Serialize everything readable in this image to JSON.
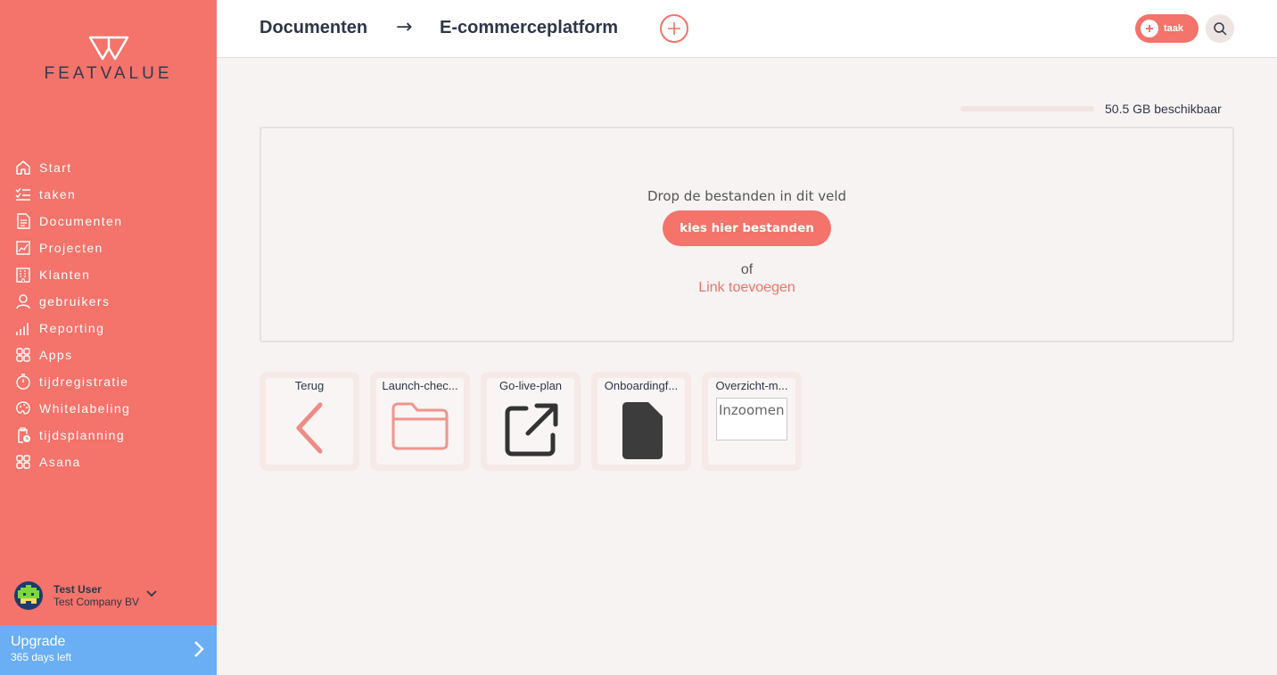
{
  "brand": {
    "name": "FEATVALUE",
    "accent": "#f4736a",
    "upgrade_color": "#6aaef4"
  },
  "sidebar": {
    "items": [
      {
        "label": "Start",
        "icon": "home-icon"
      },
      {
        "label": "taken",
        "icon": "checklist-icon"
      },
      {
        "label": "Documenten",
        "icon": "document-icon"
      },
      {
        "label": "Projecten",
        "icon": "chart-icon"
      },
      {
        "label": "Klanten",
        "icon": "building-icon"
      },
      {
        "label": "gebruikers",
        "icon": "user-icon"
      },
      {
        "label": "Reporting",
        "icon": "bar-chart-icon"
      },
      {
        "label": "Apps",
        "icon": "apps-icon"
      },
      {
        "label": "tijdregistratie",
        "icon": "stopwatch-icon"
      },
      {
        "label": "Whitelabeling",
        "icon": "palette-icon"
      },
      {
        "label": "tijdsplanning",
        "icon": "clipboard-clock-icon"
      },
      {
        "label": "Asana",
        "icon": "apps-icon"
      }
    ],
    "user": {
      "name": "Test User",
      "company": "Test Company BV"
    },
    "upgrade": {
      "title": "Upgrade",
      "subtitle": "365 days left"
    }
  },
  "header": {
    "breadcrumb": [
      "Documenten",
      "E-commerceplatform"
    ],
    "arrow": "→",
    "task_button": "taak"
  },
  "storage": {
    "text": "50.5 GB beschikbaar",
    "used_fraction": 0.0
  },
  "dropzone": {
    "prompt": "Drop de bestanden in dit veld",
    "button": "kies hier bestanden",
    "or": "of",
    "link": "Link toevoegen"
  },
  "tiles": [
    {
      "name": "Terug",
      "icon": "back-chevron-icon"
    },
    {
      "name": "Launch-chec...",
      "icon": "folder-icon"
    },
    {
      "name": "Go-live-plan",
      "icon": "external-link-icon"
    },
    {
      "name": "Onboardingf...",
      "icon": "file-icon"
    },
    {
      "name": "Overzicht-m...",
      "icon": "image-thumbnail",
      "alt": "Inzoomen"
    }
  ]
}
